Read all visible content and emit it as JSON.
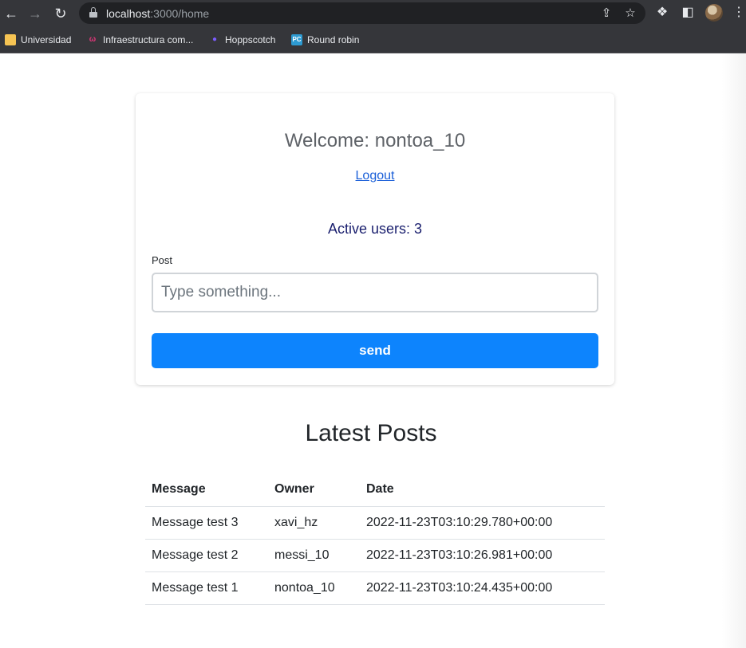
{
  "browser": {
    "url_host": "localhost",
    "url_path": ":3000/home",
    "bookmarks": [
      {
        "label": "Universidad",
        "icon": "folder-icon",
        "color": "#f6c453"
      },
      {
        "label": "Infraestructura com...",
        "icon": "infra-icon",
        "color": "#e2367a"
      },
      {
        "label": "Hoppscotch",
        "icon": "hoppscotch-icon",
        "color": "#7b5cff"
      },
      {
        "label": "Round robin",
        "icon": "pc-icon",
        "color": "#2d9bd2"
      }
    ]
  },
  "header": {
    "welcome": "Welcome: nontoa_10",
    "logout": "Logout",
    "active_users": "Active users: 3"
  },
  "form": {
    "post_label": "Post",
    "placeholder": "Type something...",
    "value": "",
    "send_label": "send"
  },
  "posts": {
    "title": "Latest Posts",
    "columns": [
      "Message",
      "Owner",
      "Date"
    ],
    "rows": [
      [
        "Message test 3",
        "xavi_hz",
        "2022-11-23T03:10:29.780+00:00"
      ],
      [
        "Message test 2",
        "messi_10",
        "2022-11-23T03:10:26.981+00:00"
      ],
      [
        "Message test 1",
        "nontoa_10",
        "2022-11-23T03:10:24.435+00:00"
      ]
    ]
  },
  "colors": {
    "primary": "#0d84fd",
    "link": "#1a5fd8",
    "chrome": "#35363a"
  }
}
